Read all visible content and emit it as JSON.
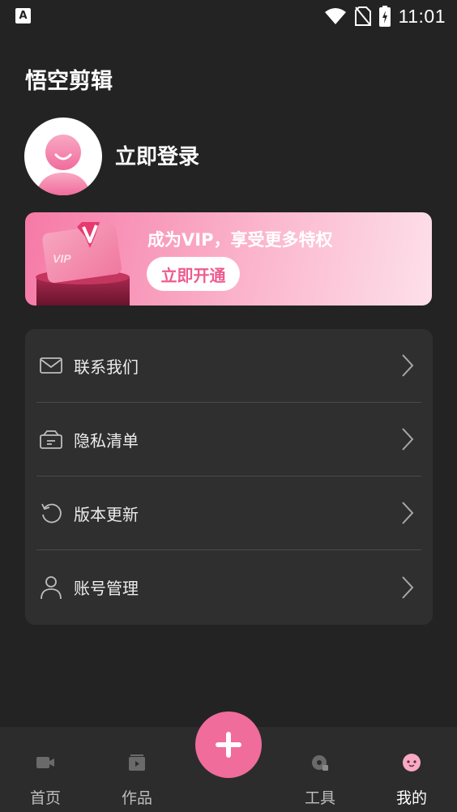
{
  "status_bar": {
    "time": "11:01",
    "app_icon": "A"
  },
  "header": {
    "title": "悟空剪辑"
  },
  "profile": {
    "login_label": "立即登录"
  },
  "vip": {
    "title": "成为VIP，享受更多特权",
    "button_label": "立即开通",
    "card_text": "VIP"
  },
  "menu": {
    "items": [
      {
        "label": "联系我们",
        "icon": "mail-icon"
      },
      {
        "label": "隐私清单",
        "icon": "privacy-list-icon"
      },
      {
        "label": "版本更新",
        "icon": "refresh-icon"
      },
      {
        "label": "账号管理",
        "icon": "user-icon"
      }
    ]
  },
  "bottom_nav": {
    "items": [
      {
        "label": "首页",
        "icon": "home-video-icon",
        "active": false
      },
      {
        "label": "作品",
        "icon": "works-icon",
        "active": false
      },
      {
        "label": "工具",
        "icon": "tools-icon",
        "active": false
      },
      {
        "label": "我的",
        "icon": "profile-face-icon",
        "active": true
      }
    ],
    "fab_icon": "plus-icon"
  },
  "colors": {
    "background": "#232323",
    "card": "#2f2f30",
    "accent": "#f06c9b",
    "nav_bar": "#2c2c2d"
  }
}
